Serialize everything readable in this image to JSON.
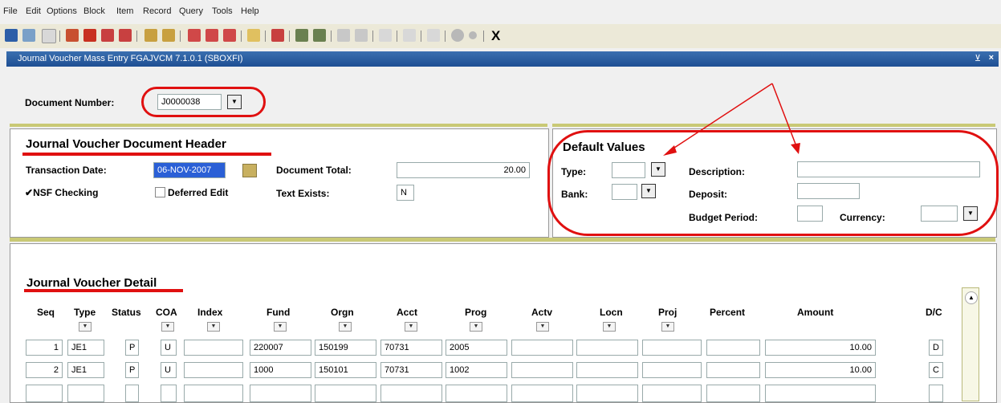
{
  "menu": [
    "File",
    "Edit",
    "Options",
    "Block",
    "Item",
    "Record",
    "Query",
    "Tools",
    "Help"
  ],
  "toolbar": {
    "close_label": "X"
  },
  "window": {
    "title": "Journal Voucher Mass Entry  FGAJVCM  7.1.0.1  (SBOXFI)",
    "close_label": "×",
    "min_label": "⊻"
  },
  "key": {
    "doc_number_label": "Document Number:",
    "doc_number_value": "J0000038"
  },
  "header": {
    "section_title": "Journal Voucher Document Header",
    "transaction_date_label": "Transaction Date:",
    "transaction_date_value": "06-NOV-2007",
    "document_total_label": "Document Total:",
    "document_total_value": "20.00",
    "nsf_label": "NSF Checking",
    "nsf_checked": true,
    "deferred_label": "Deferred Edit",
    "text_exists_label": "Text Exists:",
    "text_exists_value": "N"
  },
  "defaults": {
    "section_title": "Default Values",
    "type_label": "Type:",
    "bank_label": "Bank:",
    "description_label": "Description:",
    "deposit_label": "Deposit:",
    "budget_period_label": "Budget Period:",
    "currency_label": "Currency:"
  },
  "detail": {
    "section_title": "Journal Voucher Detail",
    "columns": [
      "Seq",
      "Type",
      "Status",
      "COA",
      "Index",
      "Fund",
      "Orgn",
      "Acct",
      "Prog",
      "Actv",
      "Locn",
      "Proj",
      "Percent",
      "Amount",
      "D/C"
    ],
    "rows": [
      {
        "seq": "1",
        "type": "JE1",
        "status": "P",
        "coa": "U",
        "index": "",
        "fund": "220007",
        "orgn": "150199",
        "acct": "70731",
        "prog": "2005",
        "actv": "",
        "locn": "",
        "proj": "",
        "percent": "",
        "amount": "10.00",
        "dc": "D"
      },
      {
        "seq": "2",
        "type": "JE1",
        "status": "P",
        "coa": "U",
        "index": "",
        "fund": "1000",
        "orgn": "150101",
        "acct": "70731",
        "prog": "1002",
        "actv": "",
        "locn": "",
        "proj": "",
        "percent": "",
        "amount": "10.00",
        "dc": "C"
      },
      {
        "seq": "",
        "type": "",
        "status": "",
        "coa": "",
        "index": "",
        "fund": "",
        "orgn": "",
        "acct": "",
        "prog": "",
        "actv": "",
        "locn": "",
        "proj": "",
        "percent": "",
        "amount": "",
        "dc": ""
      }
    ]
  },
  "colors": {
    "accent_red": "#e01010",
    "title_blue": "#1f4f93",
    "divider_yellow": "#c9c975",
    "selection_blue": "#2a5fd6"
  }
}
